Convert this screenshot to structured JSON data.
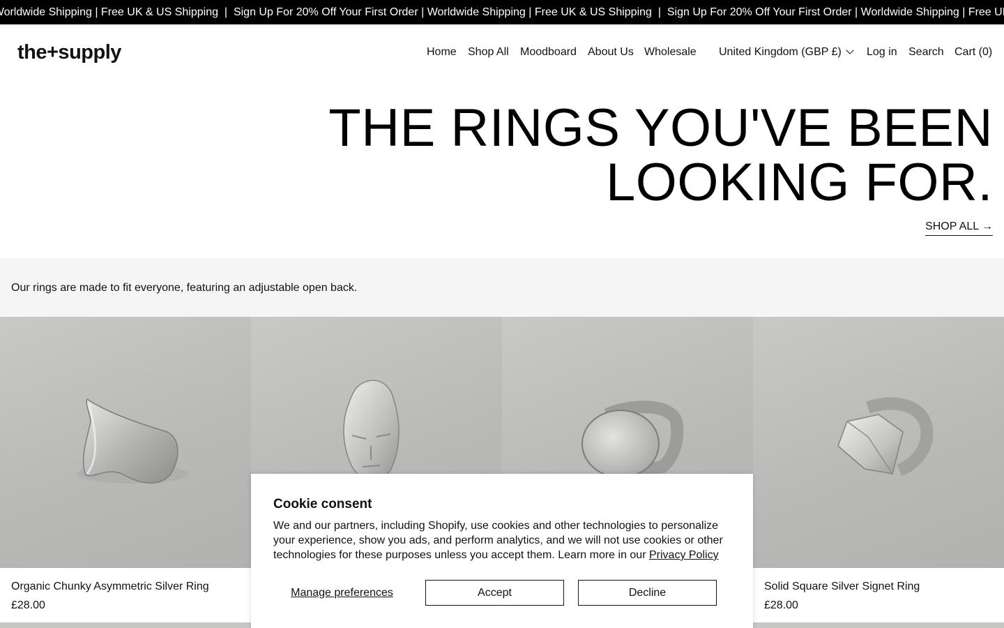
{
  "announcement": {
    "messages": [
      "Sign Up For 20% Off Your First Order | Worldwide Shipping | Free UK & US Shipping",
      "Sign Up For 20% Off Your First Order | Worldwide Shipping | Free UK & US Shipping",
      "Sign Up For 20% Off Your First Order | Worldwide Shipping | Free UK & US Shipping"
    ],
    "separator": "  |  "
  },
  "header": {
    "logo": "the+supply",
    "nav": {
      "home": "Home",
      "shop_all": "Shop All",
      "moodboard": "Moodboard",
      "about": "About Us",
      "wholesale": "Wholesale",
      "country": "United Kingdom (GBP £)",
      "login": "Log in",
      "search": "Search",
      "cart": "Cart (0)"
    }
  },
  "hero": {
    "title": "THE RINGS YOU'VE BEEN LOOKING FOR.",
    "cta": "SHOP ALL →"
  },
  "info": {
    "text": "Our rings are made to fit everyone, featuring an adjustable open back."
  },
  "products": [
    {
      "title": "Organic Chunky Asymmetric Silver Ring",
      "price": "£28.00",
      "image": "asymmetric-ring-photo"
    },
    {
      "title": "",
      "price": "",
      "image": "face-ring-photo"
    },
    {
      "title": "",
      "price": "",
      "image": "round-signet-ring-photo"
    },
    {
      "title": "Solid Square Silver Signet Ring",
      "price": "£28.00",
      "image": "square-signet-ring-photo"
    }
  ],
  "cookie": {
    "title": "Cookie consent",
    "text": "We and our partners, including Shopify, use cookies and other technologies to personalize your experience, show you ads, and perform analytics, and we will not use cookies or other technologies for these purposes unless you accept them. Learn more in our ",
    "policy_link": "Privacy Policy",
    "manage": "Manage preferences",
    "accept": "Accept",
    "decline": "Decline"
  },
  "colors": {
    "announcement_bg": "#000000",
    "strip_bg": "#f5f5f5",
    "photo_bg": "#c0c1bf"
  }
}
